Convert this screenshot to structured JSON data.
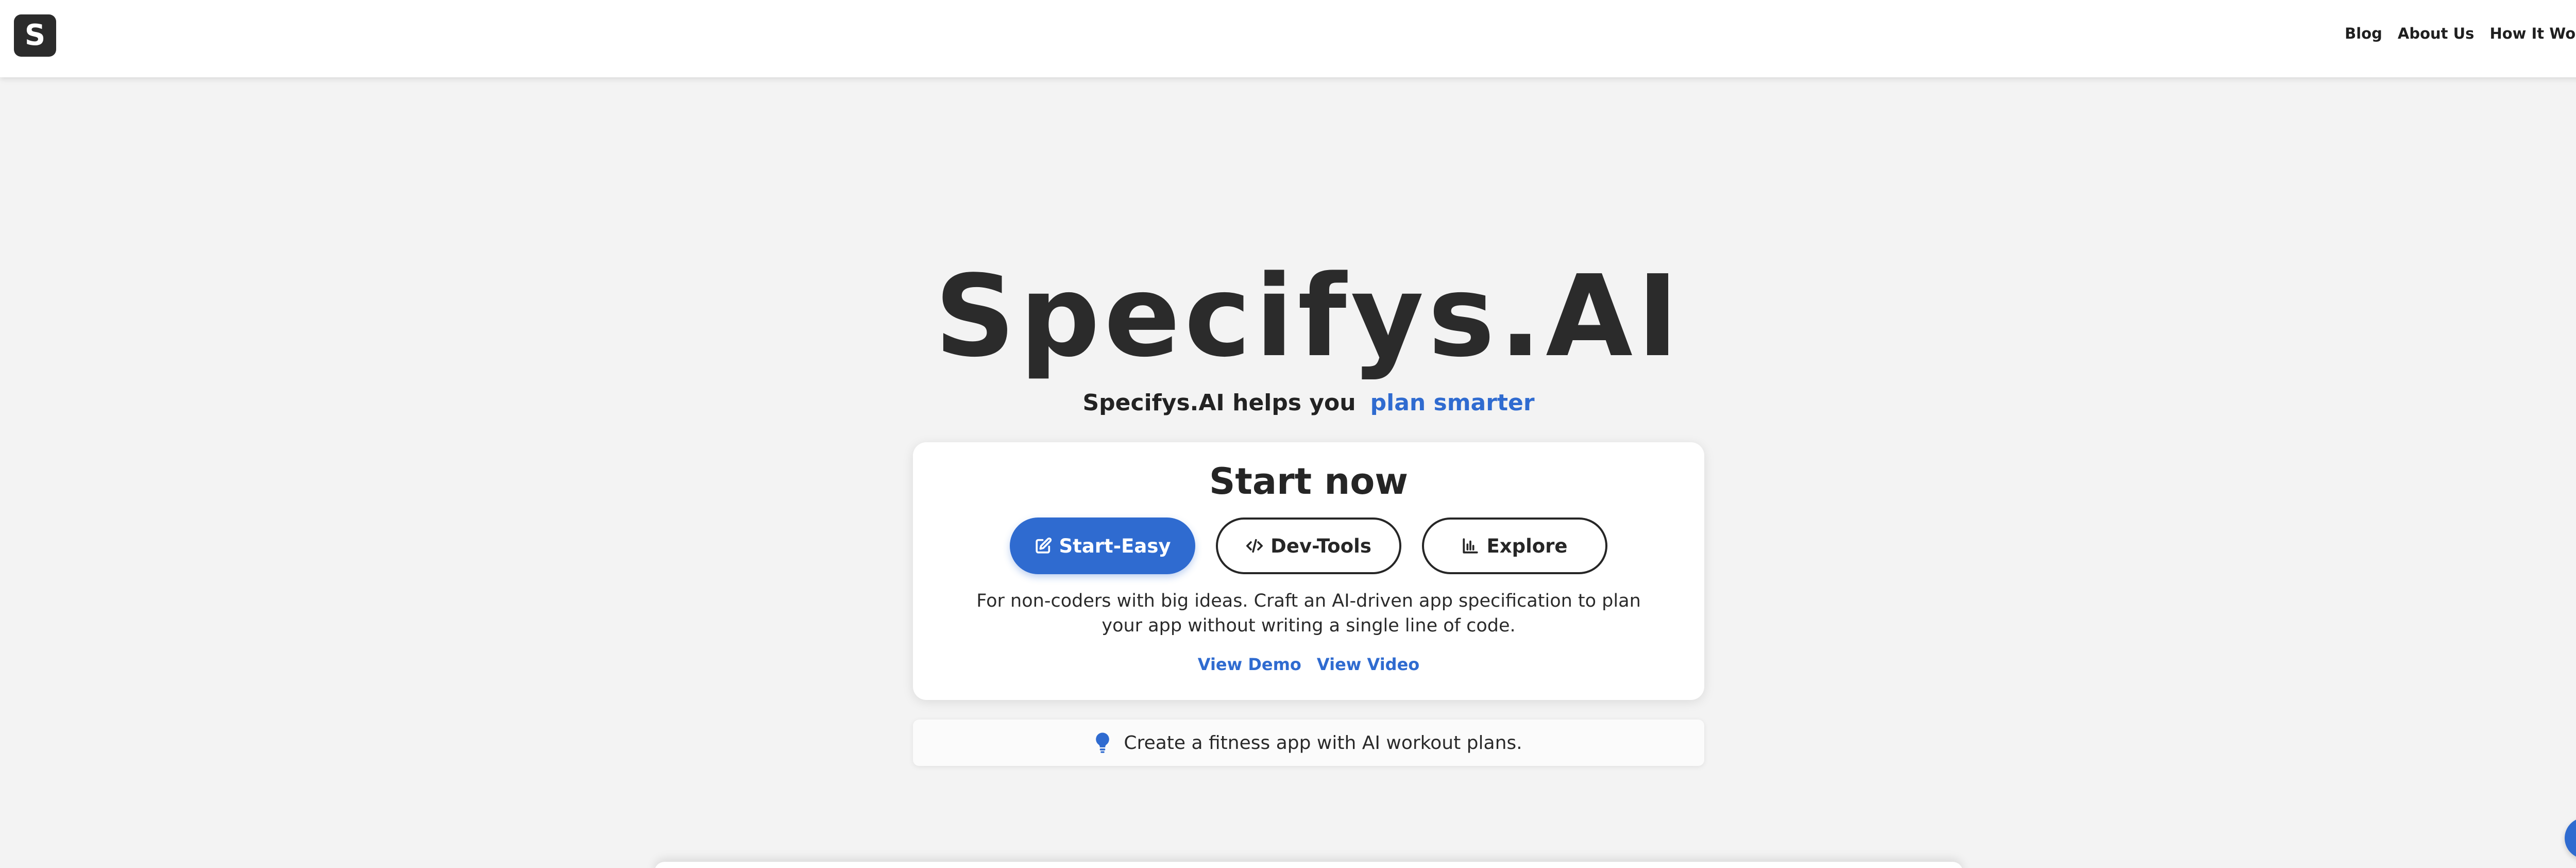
{
  "header": {
    "logo_letter": "S",
    "nav": [
      "Blog",
      "About Us",
      "How It Works"
    ]
  },
  "hero": {
    "title": "Specifys.AI",
    "tagline_prefix": "Specifys.AI helps you",
    "tagline_accent": "plan smarter",
    "accent_color": "#2f6bd0"
  },
  "card": {
    "title": "Start now",
    "buttons": [
      {
        "label": "Start-Easy",
        "icon": "edit-icon",
        "active": true
      },
      {
        "label": "Dev-Tools",
        "icon": "code-icon",
        "active": false
      },
      {
        "label": "Explore",
        "icon": "bar-chart-icon",
        "active": false
      }
    ],
    "description": "For non-coders with big ideas. Craft an AI-driven app specification to plan your app without writing a single line of code.",
    "links": [
      "View Demo",
      "View Video"
    ]
  },
  "suggestion": {
    "icon": "lightbulb-icon",
    "text": "Create a fitness app with AI workout plans."
  },
  "scroll_button": {
    "icon": "arrow-down-icon"
  }
}
